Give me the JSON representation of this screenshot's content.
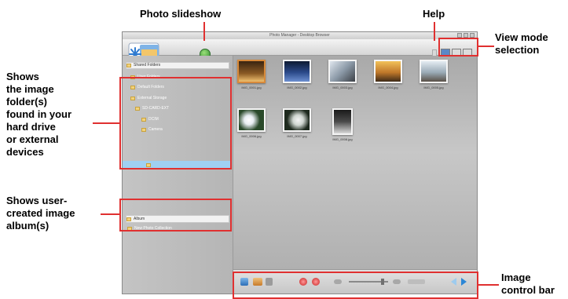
{
  "annotations": {
    "photo_slideshow": "Photo slideshow",
    "help": "Help",
    "view_mode": "View mode\nselection",
    "image_folders": "Shows\nthe image\nfolder(s)\nfound in your\nhard drive\nor external\ndevices",
    "user_albums": "Shows user-\ncreated image\nalbum(s)",
    "control_bar": "Image\ncontrol bar"
  },
  "window": {
    "title": "Photo Manager - Desktop Browser"
  },
  "sidebar": {
    "folders": [
      {
        "label": "Shared Folders"
      },
      {
        "label": "User Folders"
      },
      {
        "label": "Default Folders"
      },
      {
        "label": "External Storage"
      },
      {
        "label": "SD-CARD-EXT"
      },
      {
        "label": "DCIM"
      },
      {
        "label": "Camera"
      },
      {
        "label": ""
      }
    ],
    "albums": [
      {
        "label": "Album"
      },
      {
        "label": "New Photo Collection"
      }
    ]
  },
  "thumbnails": [
    {
      "caption": "IMG_0001.jpg"
    },
    {
      "caption": "IMG_0002.jpg"
    },
    {
      "caption": "IMG_0003.jpg"
    },
    {
      "caption": "IMG_0004.jpg"
    },
    {
      "caption": "IMG_0005.jpg"
    },
    {
      "caption": "IMG_0006.jpg"
    },
    {
      "caption": "IMG_0007.jpg"
    },
    {
      "caption": "IMG_0008.jpg"
    }
  ],
  "colors": {
    "annotation": "#e03030",
    "selection": "#9fd0f2"
  }
}
